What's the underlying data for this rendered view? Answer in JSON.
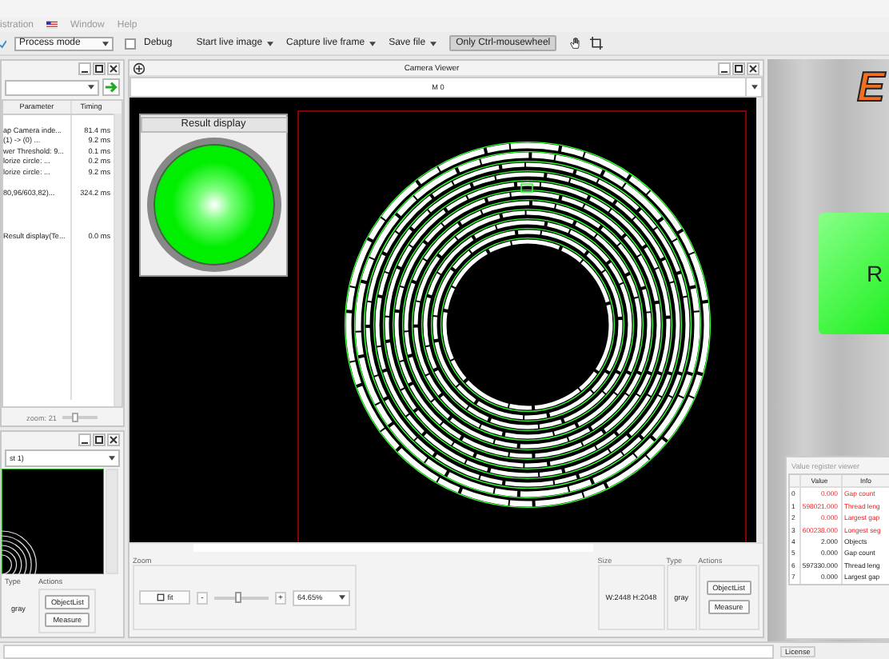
{
  "menu": {
    "items": [
      "istration",
      "Window",
      "Help"
    ]
  },
  "toolbar": {
    "mode": "Process mode",
    "debug": {
      "label": "Debug",
      "checked": false
    },
    "start_live": "Start live image",
    "capture": "Capture live frame",
    "save": "Save file",
    "ctrl_wheel": {
      "label": "Only Ctrl-mousewheel",
      "on": true
    }
  },
  "steps_panel": {
    "columns": [
      "Parameter",
      "Timing"
    ],
    "rows": [
      {},
      {
        "parameter": "ap Camera inde...",
        "timing": "81.4 ms"
      },
      {
        "parameter": "(1) -> (0) ...",
        "timing": "9.2 ms"
      },
      {
        "parameter": "wer Threshold: 9...",
        "timing": "0.1 ms"
      },
      {
        "parameter": "lorize circle: ...",
        "timing": "0.2 ms"
      },
      {
        "parameter": "lorize circle: ...",
        "timing": "9.2 ms"
      },
      {},
      {
        "parameter": "80,96/603,82)...",
        "timing": "324.2 ms"
      },
      {},
      {},
      {},
      {
        "parameter": "Result display(Te...",
        "timing": "0.0 ms"
      }
    ],
    "zoom_label": "zoom: 21",
    "zoom": {
      "level": 0.35
    }
  },
  "small_viewer": {
    "source": "st 1)",
    "type_label": "Type",
    "actions_label": "Actions",
    "type": "gray",
    "buttons": [
      "ObjectList",
      "Measure"
    ]
  },
  "camera_viewer": {
    "title": "Camera Viewer",
    "source": "M 0",
    "result_display": {
      "title": "Result display",
      "ok": true
    },
    "zoom_label": "Zoom",
    "fit": "fit",
    "minus": "-",
    "plus": "+",
    "zoom": {
      "level": 0.45
    },
    "zoom_value": "64.65%",
    "size_label": "Size",
    "size": "W:2448  H:2048",
    "type_label": "Type",
    "type": "gray",
    "actions_label": "Actions",
    "buttons": [
      "ObjectList",
      "Measure"
    ]
  },
  "logo_text": "E",
  "result_banner": {
    "text": "R",
    "ok": true
  },
  "value_register": {
    "title": "Value register viewer",
    "columns": [
      "Value",
      "Info"
    ],
    "rows": [
      {
        "index": "0",
        "value": "0.000",
        "info": "Gap count",
        "alarm": true
      },
      {
        "index": "1",
        "value": "598021.000",
        "info": "Thread leng",
        "alarm": true
      },
      {
        "index": "2",
        "value": "0.000",
        "info": "Largest gap",
        "alarm": true
      },
      {
        "index": "3",
        "value": "600238.000",
        "info": "Longest seg",
        "alarm": true
      },
      {
        "index": "4",
        "value": "2.000",
        "info": "Objects",
        "alarm": false
      },
      {
        "index": "5",
        "value": "0.000",
        "info": "Gap count",
        "alarm": false
      },
      {
        "index": "6",
        "value": "597330.000",
        "info": "Thread leng",
        "alarm": false
      },
      {
        "index": "7",
        "value": "0.000",
        "info": "Largest gap",
        "alarm": false
      }
    ]
  },
  "status_bar": {
    "license": "License"
  }
}
